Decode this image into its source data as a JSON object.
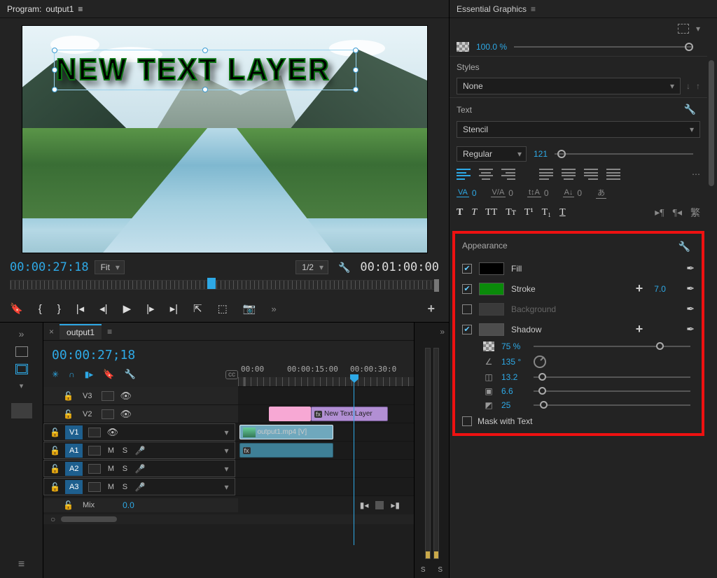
{
  "program": {
    "label": "Program:",
    "name": "output1",
    "text_layer": "NEW TEXT LAYER",
    "current_tc": "00:00:27:18",
    "fit": "Fit",
    "zoom": "1/2",
    "duration_tc": "00:01:00:00"
  },
  "timeline": {
    "tab": "output1",
    "tc": "00:00:27;18",
    "ruler": {
      "t0": "00:00",
      "t1": "00:00:15:00",
      "t2": "00:00:30:0"
    },
    "tracks": {
      "v3": "V3",
      "v2": "V2",
      "v1": "V1",
      "a1": "A1",
      "a2": "A2",
      "a3": "A3",
      "mix": "Mix",
      "mix_val": "0.0"
    },
    "clips": {
      "text_layer": "New Text Layer",
      "video": "output1.mp4 [V]"
    },
    "meters": {
      "l": "S",
      "r": "S"
    }
  },
  "essential_graphics": {
    "title": "Essential Graphics",
    "opacity": "100.0 %"
  },
  "styles": {
    "title": "Styles",
    "value": "None"
  },
  "text": {
    "title": "Text",
    "font": "Stencil",
    "weight": "Regular",
    "size": "121",
    "tracking": "0",
    "kerning": "0",
    "leading": "0",
    "baseline": "0",
    "bold": "T",
    "italic": "T",
    "allcaps": "TT",
    "smallcaps": "Tᴛ",
    "sup": "T¹",
    "sub": "T₁",
    "underline": "T"
  },
  "appearance": {
    "title": "Appearance",
    "fill": {
      "label": "Fill",
      "enabled": true,
      "color": "#000000"
    },
    "stroke": {
      "label": "Stroke",
      "enabled": true,
      "color": "#0a8a0a",
      "width": "7.0"
    },
    "background": {
      "label": "Background",
      "enabled": false,
      "color": "#4d4d4d"
    },
    "shadow": {
      "label": "Shadow",
      "enabled": true,
      "color": "#4d4d4d",
      "opacity": "75 %",
      "angle": "135 °",
      "distance": "13.2",
      "spread": "6.6",
      "blur": "25"
    },
    "mask": "Mask with Text"
  }
}
